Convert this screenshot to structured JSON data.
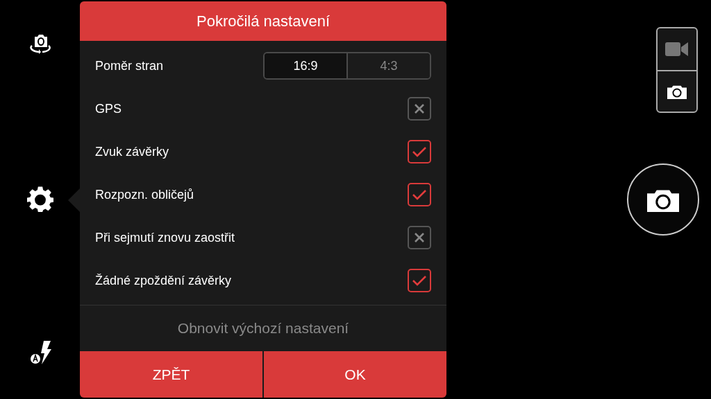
{
  "dialog": {
    "title": "Pokročilá nastavení",
    "settings": [
      {
        "kind": "segmented",
        "label": "Poměr stran",
        "options": [
          {
            "label": "16:9",
            "selected": true
          },
          {
            "label": "4:3",
            "selected": false
          }
        ]
      },
      {
        "kind": "checkbox",
        "label": "GPS",
        "checked": false
      },
      {
        "kind": "checkbox",
        "label": "Zvuk závěrky",
        "checked": true
      },
      {
        "kind": "checkbox",
        "label": "Rozpozn. obličejů",
        "checked": true
      },
      {
        "kind": "checkbox",
        "label": "Při sejmutí znovu zaostřit",
        "checked": false
      },
      {
        "kind": "checkbox",
        "label": "Žádné zpoždění závěrky",
        "checked": true
      }
    ],
    "reset": "Obnovit výchozí nastavení",
    "buttons": [
      "ZPĚT",
      "OK"
    ]
  },
  "mode_switch": [
    {
      "kind": "video",
      "selected": false
    },
    {
      "kind": "photo",
      "selected": true
    }
  ]
}
